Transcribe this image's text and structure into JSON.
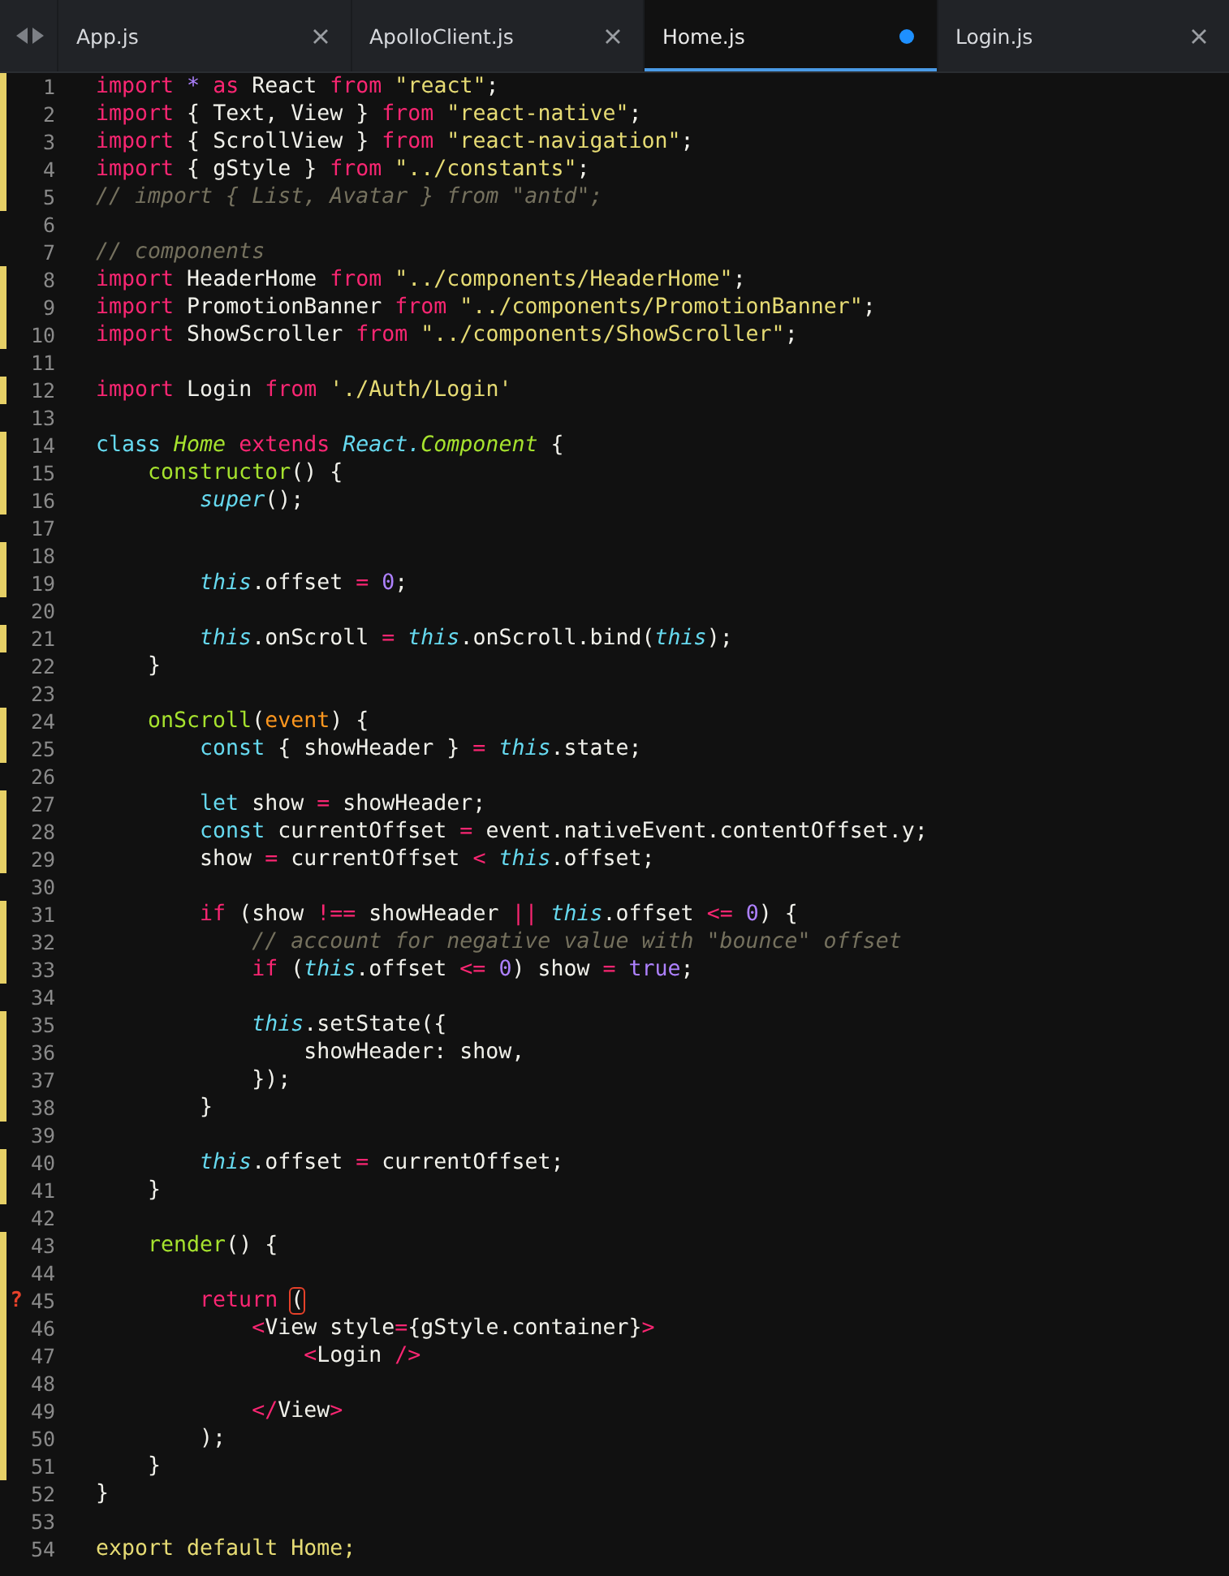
{
  "tabs": [
    {
      "label": "App.js",
      "selected": false,
      "modified": false
    },
    {
      "label": "ApolloClient.js",
      "selected": false,
      "modified": false
    },
    {
      "label": "Home.js",
      "selected": true,
      "modified": true
    },
    {
      "label": "Login.js",
      "selected": false,
      "modified": false
    }
  ],
  "lines": [
    {
      "number": "1",
      "modified": true,
      "tokens": [
        {
          "kind": "keyword",
          "text": "import"
        },
        {
          "kind": "constant",
          "text": " *"
        },
        {
          "kind": "keyword",
          "text": " as"
        },
        {
          "kind": "plain",
          "text": " React "
        },
        {
          "kind": "keyword",
          "text": "from"
        },
        {
          "kind": "string",
          "text": " \"react\""
        },
        {
          "kind": "plain",
          "text": ";"
        }
      ]
    },
    {
      "number": "2",
      "modified": true,
      "tokens": [
        {
          "kind": "keyword",
          "text": "import"
        },
        {
          "kind": "plain",
          "text": " { Text, View } "
        },
        {
          "kind": "keyword",
          "text": "from"
        },
        {
          "kind": "string",
          "text": " \"react-native\""
        },
        {
          "kind": "plain",
          "text": ";"
        }
      ]
    },
    {
      "number": "3",
      "modified": true,
      "tokens": [
        {
          "kind": "keyword",
          "text": "import"
        },
        {
          "kind": "plain",
          "text": " { ScrollView } "
        },
        {
          "kind": "keyword",
          "text": "from"
        },
        {
          "kind": "string",
          "text": " \"react-navigation\""
        },
        {
          "kind": "plain",
          "text": ";"
        }
      ]
    },
    {
      "number": "4",
      "modified": true,
      "tokens": [
        {
          "kind": "keyword",
          "text": "import"
        },
        {
          "kind": "plain",
          "text": " { gStyle } "
        },
        {
          "kind": "keyword",
          "text": "from"
        },
        {
          "kind": "string",
          "text": " \"../constants\""
        },
        {
          "kind": "plain",
          "text": ";"
        }
      ]
    },
    {
      "number": "5",
      "modified": true,
      "tokens": [
        {
          "kind": "comment",
          "text": "// import { List, Avatar } from \"antd\";"
        }
      ]
    },
    {
      "number": "6",
      "modified": false
    },
    {
      "number": "7",
      "modified": false,
      "tokens": [
        {
          "kind": "comment",
          "text": "// components"
        }
      ]
    },
    {
      "number": "8",
      "modified": true,
      "tokens": [
        {
          "kind": "keyword",
          "text": "import"
        },
        {
          "kind": "plain",
          "text": " HeaderHome "
        },
        {
          "kind": "keyword",
          "text": "from"
        },
        {
          "kind": "string",
          "text": " \"../components/HeaderHome\""
        },
        {
          "kind": "plain",
          "text": ";"
        }
      ]
    },
    {
      "number": "9",
      "modified": true,
      "tokens": [
        {
          "kind": "keyword",
          "text": "import"
        },
        {
          "kind": "plain",
          "text": " PromotionBanner "
        },
        {
          "kind": "keyword",
          "text": "from"
        },
        {
          "kind": "string",
          "text": " \"../components/PromotionBanner\""
        },
        {
          "kind": "plain",
          "text": ";"
        }
      ]
    },
    {
      "number": "10",
      "modified": true,
      "tokens": [
        {
          "kind": "keyword",
          "text": "import"
        },
        {
          "kind": "plain",
          "text": " ShowScroller "
        },
        {
          "kind": "keyword",
          "text": "from"
        },
        {
          "kind": "string",
          "text": " \"../components/ShowScroller\""
        },
        {
          "kind": "plain",
          "text": ";"
        }
      ]
    },
    {
      "number": "11",
      "modified": false
    },
    {
      "number": "12",
      "modified": true,
      "tokens": [
        {
          "kind": "keyword",
          "text": "import"
        },
        {
          "kind": "plain",
          "text": " Login "
        },
        {
          "kind": "keyword",
          "text": "from"
        },
        {
          "kind": "string",
          "text": " './Auth/Login'"
        }
      ]
    },
    {
      "number": "13",
      "modified": false
    },
    {
      "number": "14",
      "modified": true,
      "tokens": [
        {
          "kind": "storage",
          "text": "class"
        },
        {
          "kind": "class",
          "text": " Home"
        },
        {
          "kind": "keyword",
          "text": " extends"
        },
        {
          "kind": "this",
          "text": " React."
        },
        {
          "kind": "class",
          "text": "Component"
        },
        {
          "kind": "plain",
          "text": " {"
        }
      ]
    },
    {
      "number": "15",
      "modified": true,
      "tokens": [
        {
          "kind": "function",
          "text": "    constructor"
        },
        {
          "kind": "plain",
          "text": "() {"
        }
      ]
    },
    {
      "number": "16",
      "modified": true,
      "tokens": [
        {
          "kind": "this",
          "text": "        super"
        },
        {
          "kind": "plain",
          "text": "();"
        }
      ]
    },
    {
      "number": "17",
      "modified": false
    },
    {
      "number": "18",
      "modified": true
    },
    {
      "number": "19",
      "modified": true,
      "tokens": [
        {
          "kind": "this",
          "text": "        this"
        },
        {
          "kind": "plain",
          "text": ".offset "
        },
        {
          "kind": "operator",
          "text": "="
        },
        {
          "kind": "constant",
          "text": " 0"
        },
        {
          "kind": "plain",
          "text": ";"
        }
      ]
    },
    {
      "number": "20",
      "modified": false
    },
    {
      "number": "21",
      "modified": true,
      "tokens": [
        {
          "kind": "this",
          "text": "        this"
        },
        {
          "kind": "plain",
          "text": ".onScroll "
        },
        {
          "kind": "operator",
          "text": "="
        },
        {
          "kind": "this",
          "text": " this"
        },
        {
          "kind": "plain",
          "text": ".onScroll.bind("
        },
        {
          "kind": "this",
          "text": "this"
        },
        {
          "kind": "plain",
          "text": ");"
        }
      ]
    },
    {
      "number": "22",
      "modified": false,
      "tokens": [
        {
          "kind": "plain",
          "text": "    }"
        }
      ]
    },
    {
      "number": "23",
      "modified": false
    },
    {
      "number": "24",
      "modified": true,
      "tokens": [
        {
          "kind": "function",
          "text": "    onScroll"
        },
        {
          "kind": "plain",
          "text": "("
        },
        {
          "kind": "param",
          "text": "event"
        },
        {
          "kind": "plain",
          "text": ") {"
        }
      ]
    },
    {
      "number": "25",
      "modified": true,
      "tokens": [
        {
          "kind": "storage",
          "text": "        const"
        },
        {
          "kind": "plain",
          "text": " { showHeader } "
        },
        {
          "kind": "operator",
          "text": "="
        },
        {
          "kind": "this",
          "text": " this"
        },
        {
          "kind": "plain",
          "text": ".state;"
        }
      ]
    },
    {
      "number": "26",
      "modified": false
    },
    {
      "number": "27",
      "modified": true,
      "tokens": [
        {
          "kind": "storage",
          "text": "        let"
        },
        {
          "kind": "plain",
          "text": " show "
        },
        {
          "kind": "operator",
          "text": "="
        },
        {
          "kind": "plain",
          "text": " showHeader;"
        }
      ]
    },
    {
      "number": "28",
      "modified": true,
      "tokens": [
        {
          "kind": "storage",
          "text": "        const"
        },
        {
          "kind": "plain",
          "text": " currentOffset "
        },
        {
          "kind": "operator",
          "text": "="
        },
        {
          "kind": "plain",
          "text": " event.nativeEvent.contentOffset.y;"
        }
      ]
    },
    {
      "number": "29",
      "modified": true,
      "tokens": [
        {
          "kind": "plain",
          "text": "        show "
        },
        {
          "kind": "operator",
          "text": "="
        },
        {
          "kind": "plain",
          "text": " currentOffset "
        },
        {
          "kind": "operator",
          "text": "<"
        },
        {
          "kind": "this",
          "text": " this"
        },
        {
          "kind": "plain",
          "text": ".offset;"
        }
      ]
    },
    {
      "number": "30",
      "modified": false
    },
    {
      "number": "31",
      "modified": true,
      "tokens": [
        {
          "kind": "keyword",
          "text": "        if"
        },
        {
          "kind": "plain",
          "text": " (show "
        },
        {
          "kind": "operator",
          "text": "!=="
        },
        {
          "kind": "plain",
          "text": " showHeader "
        },
        {
          "kind": "operator",
          "text": "||"
        },
        {
          "kind": "this",
          "text": " this"
        },
        {
          "kind": "plain",
          "text": ".offset "
        },
        {
          "kind": "operator",
          "text": "<="
        },
        {
          "kind": "constant",
          "text": " 0"
        },
        {
          "kind": "plain",
          "text": ") {"
        }
      ]
    },
    {
      "number": "32",
      "modified": true,
      "tokens": [
        {
          "kind": "comment",
          "text": "            // account for negative value with \"bounce\" offset"
        }
      ]
    },
    {
      "number": "33",
      "modified": true,
      "tokens": [
        {
          "kind": "keyword",
          "text": "            if"
        },
        {
          "kind": "plain",
          "text": " ("
        },
        {
          "kind": "this",
          "text": "this"
        },
        {
          "kind": "plain",
          "text": ".offset "
        },
        {
          "kind": "operator",
          "text": "<="
        },
        {
          "kind": "constant",
          "text": " 0"
        },
        {
          "kind": "plain",
          "text": ") show "
        },
        {
          "kind": "operator",
          "text": "="
        },
        {
          "kind": "constant",
          "text": " true"
        },
        {
          "kind": "plain",
          "text": ";"
        }
      ]
    },
    {
      "number": "34",
      "modified": false
    },
    {
      "number": "35",
      "modified": true,
      "tokens": [
        {
          "kind": "this",
          "text": "            this"
        },
        {
          "kind": "plain",
          "text": ".setState({"
        }
      ]
    },
    {
      "number": "36",
      "modified": true,
      "tokens": [
        {
          "kind": "plain",
          "text": "                showHeader: show,"
        }
      ]
    },
    {
      "number": "37",
      "modified": true,
      "tokens": [
        {
          "kind": "plain",
          "text": "            });"
        }
      ]
    },
    {
      "number": "38",
      "modified": true,
      "tokens": [
        {
          "kind": "plain",
          "text": "        }"
        }
      ]
    },
    {
      "number": "39",
      "modified": false
    },
    {
      "number": "40",
      "modified": true,
      "tokens": [
        {
          "kind": "this",
          "text": "        this"
        },
        {
          "kind": "plain",
          "text": ".offset "
        },
        {
          "kind": "operator",
          "text": "="
        },
        {
          "kind": "plain",
          "text": " currentOffset;"
        }
      ]
    },
    {
      "number": "41",
      "modified": true,
      "tokens": [
        {
          "kind": "plain",
          "text": "    }"
        }
      ]
    },
    {
      "number": "42",
      "modified": false
    },
    {
      "number": "43",
      "modified": true,
      "tokens": [
        {
          "kind": "function",
          "text": "    render"
        },
        {
          "kind": "plain",
          "text": "() {"
        }
      ]
    },
    {
      "number": "44",
      "modified": true
    },
    {
      "number": "45",
      "modified": true,
      "gutter_mark": "?",
      "tokens": [
        {
          "kind": "keyword",
          "text": "        return "
        },
        {
          "kind": "bracket-error",
          "text": "("
        }
      ]
    },
    {
      "number": "46",
      "modified": true,
      "tokens": [
        {
          "kind": "operator",
          "text": "            <"
        },
        {
          "kind": "plain",
          "text": "View style"
        },
        {
          "kind": "operator",
          "text": "="
        },
        {
          "kind": "plain",
          "text": "{gStyle.container}"
        },
        {
          "kind": "operator",
          "text": ">"
        }
      ]
    },
    {
      "number": "47",
      "modified": true,
      "tokens": [
        {
          "kind": "operator",
          "text": "                <"
        },
        {
          "kind": "plain",
          "text": "Login "
        },
        {
          "kind": "operator",
          "text": "/>"
        }
      ]
    },
    {
      "number": "48",
      "modified": true
    },
    {
      "number": "49",
      "modified": true,
      "tokens": [
        {
          "kind": "operator",
          "text": "            </"
        },
        {
          "kind": "plain",
          "text": "View"
        },
        {
          "kind": "operator",
          "text": ">"
        }
      ]
    },
    {
      "number": "50",
      "modified": true,
      "tokens": [
        {
          "kind": "plain",
          "text": "        );"
        }
      ]
    },
    {
      "number": "51",
      "modified": true,
      "tokens": [
        {
          "kind": "plain",
          "text": "    }"
        }
      ]
    },
    {
      "number": "52",
      "modified": false,
      "tokens": [
        {
          "kind": "plain",
          "text": "}"
        }
      ]
    },
    {
      "number": "53",
      "modified": false
    },
    {
      "number": "54",
      "modified": false,
      "tokens": [
        {
          "kind": "module",
          "text": "export default Home;"
        }
      ]
    }
  ]
}
